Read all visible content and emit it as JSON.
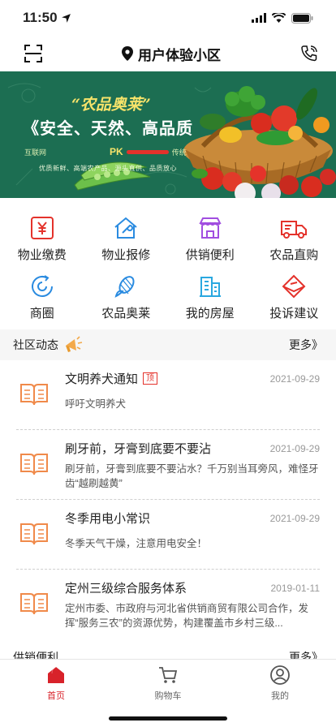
{
  "status_bar": {
    "time": "11:50"
  },
  "header": {
    "title": "用户体验小区"
  },
  "banner": {
    "title": "“农品奥莱”",
    "slogan": "《安全、天然、高品质",
    "pk_left": "互联网",
    "pk": "PK",
    "pk_right": "传统",
    "sub": "优质新鲜、高端农产品、源头直供、品质放心"
  },
  "menu": [
    {
      "label": "物业缴费",
      "icon": "yuan-receipt-icon",
      "color": "#e4322b"
    },
    {
      "label": "物业报修",
      "icon": "house-wrench-icon",
      "color": "#2a8be0"
    },
    {
      "label": "供销便利",
      "icon": "store-icon",
      "color": "#a14ee0"
    },
    {
      "label": "农品直购",
      "icon": "delivery-truck-icon",
      "color": "#e4322b"
    },
    {
      "label": "商圈",
      "icon": "refresh-circle-icon",
      "color": "#2a8be0"
    },
    {
      "label": "农品奥莱",
      "icon": "corn-icon",
      "color": "#2a8be0"
    },
    {
      "label": "我的房屋",
      "icon": "building-icon",
      "color": "#2aa8e0"
    },
    {
      "label": "投诉建议",
      "icon": "envelope-icon",
      "color": "#e4322b"
    }
  ],
  "community": {
    "title": "社区动态",
    "more": "更多》",
    "items": [
      {
        "title": "文明养犬通知",
        "tag": "顶",
        "date": "2021-09-29",
        "desc": "呼吁文明养犬"
      },
      {
        "title": "刷牙前，牙膏到底要不要沾",
        "tag": "",
        "date": "2021-09-29",
        "desc": "刷牙前，牙膏到底要不要沾水？千万别当耳旁风，难怪牙齿“越刷越黄”"
      },
      {
        "title": "冬季用电小常识",
        "tag": "",
        "date": "2021-09-29",
        "desc": "冬季天气干燥，注意用电安全！"
      },
      {
        "title": "定州三级综合服务体系",
        "tag": "",
        "date": "2019-01-11",
        "desc": "定州市委、市政府与河北省供销商贸有限公司合作，发挥“服务三农”的资源优势，构建覆盖市乡村三级..."
      }
    ]
  },
  "next_section": {
    "title": "供销便利",
    "more": "更多》"
  },
  "tabs": [
    {
      "label": "首页",
      "icon": "home-icon",
      "active": true
    },
    {
      "label": "购物车",
      "icon": "cart-icon",
      "active": false
    },
    {
      "label": "我的",
      "icon": "user-icon",
      "active": false
    }
  ]
}
